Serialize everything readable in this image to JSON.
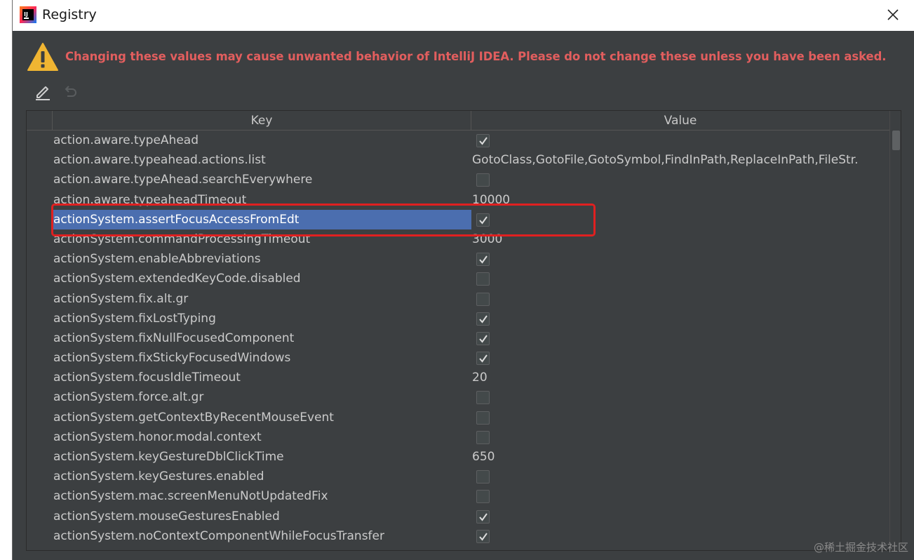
{
  "window": {
    "title": "Registry"
  },
  "warning": {
    "text": "Changing these values may cause unwanted behavior of IntelliJ IDEA. Please do not change these unless you have been asked."
  },
  "table": {
    "columns": [
      "Key",
      "Value"
    ],
    "rows": [
      {
        "key": "action.aware.typeAhead",
        "type": "bool",
        "value": true
      },
      {
        "key": "action.aware.typeahead.actions.list",
        "type": "text",
        "value": "GotoClass,GotoFile,GotoSymbol,FindInPath,ReplaceInPath,FileStr."
      },
      {
        "key": "action.aware.typeAhead.searchEverywhere",
        "type": "bool",
        "value": false
      },
      {
        "key": "action.aware.typeaheadTimeout",
        "type": "text",
        "value": "10000"
      },
      {
        "key": "actionSystem.assertFocusAccessFromEdt",
        "type": "bool",
        "value": true,
        "selected": true
      },
      {
        "key": "actionSystem.commandProcessingTimeout",
        "type": "text",
        "value": "3000"
      },
      {
        "key": "actionSystem.enableAbbreviations",
        "type": "bool",
        "value": true
      },
      {
        "key": "actionSystem.extendedKeyCode.disabled",
        "type": "bool",
        "value": false
      },
      {
        "key": "actionSystem.fix.alt.gr",
        "type": "bool",
        "value": false
      },
      {
        "key": "actionSystem.fixLostTyping",
        "type": "bool",
        "value": true
      },
      {
        "key": "actionSystem.fixNullFocusedComponent",
        "type": "bool",
        "value": true
      },
      {
        "key": "actionSystem.fixStickyFocusedWindows",
        "type": "bool",
        "value": true
      },
      {
        "key": "actionSystem.focusIdleTimeout",
        "type": "text",
        "value": "20"
      },
      {
        "key": "actionSystem.force.alt.gr",
        "type": "bool",
        "value": false
      },
      {
        "key": "actionSystem.getContextByRecentMouseEvent",
        "type": "bool",
        "value": false
      },
      {
        "key": "actionSystem.honor.modal.context",
        "type": "bool",
        "value": false
      },
      {
        "key": "actionSystem.keyGestureDblClickTime",
        "type": "text",
        "value": "650"
      },
      {
        "key": "actionSystem.keyGestures.enabled",
        "type": "bool",
        "value": false
      },
      {
        "key": "actionSystem.mac.screenMenuNotUpdatedFix",
        "type": "bool",
        "value": false
      },
      {
        "key": "actionSystem.mouseGesturesEnabled",
        "type": "bool",
        "value": true
      },
      {
        "key": "actionSystem.noContextComponentWhileFocusTransfer",
        "type": "bool",
        "value": true
      }
    ]
  },
  "watermark": "@稀土掘金技术社区",
  "colors": {
    "background": "#3c3f41",
    "selection": "#4b6eaf",
    "warning_text": "#e25e5e",
    "highlight_annotation": "#e02020"
  },
  "icons": {
    "app": "intellij-app-icon",
    "close": "close-icon",
    "warning": "warning-triangle-icon",
    "edit": "edit-pencil-icon",
    "revert": "revert-icon"
  }
}
